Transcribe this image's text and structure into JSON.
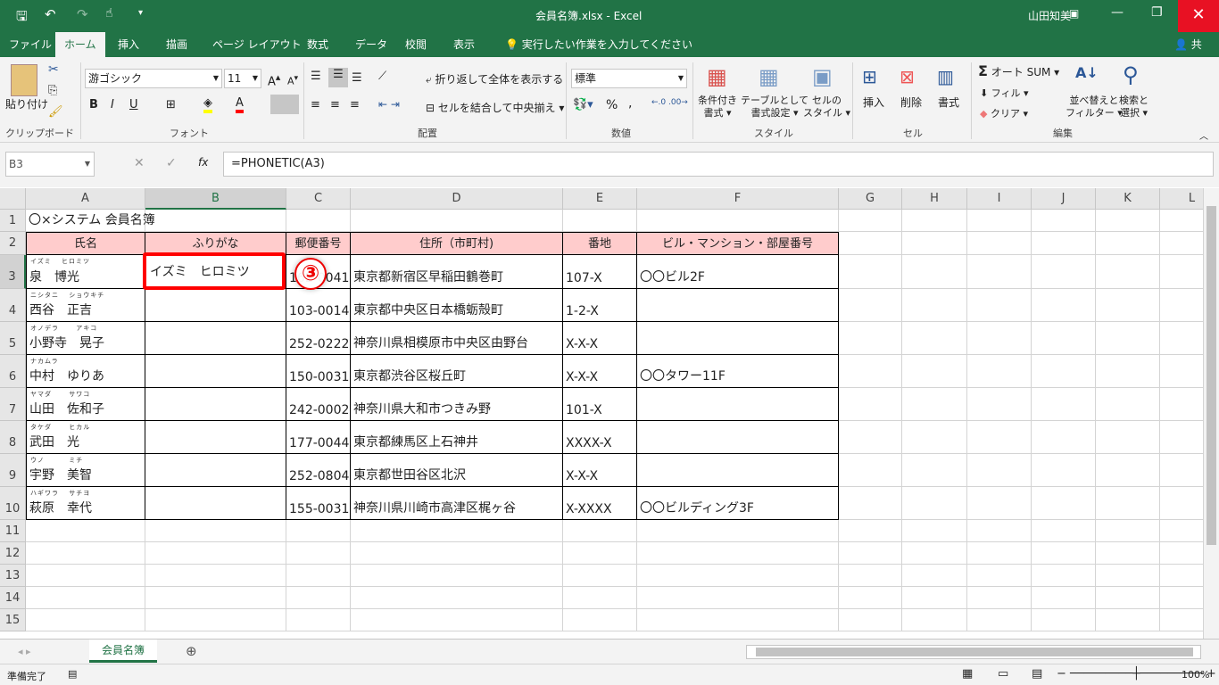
{
  "window": {
    "title": "会員名簿.xlsx  -  Excel",
    "user": "山田知美"
  },
  "tabs": [
    "ファイル",
    "ホーム",
    "挿入",
    "描画",
    "ページ レイアウト",
    "数式",
    "データ",
    "校閲",
    "表示"
  ],
  "tell_me": "実行したい作業を入力してください",
  "share": "共有",
  "ribbon": {
    "clipboard": {
      "paste": "貼り付け",
      "group": "クリップボード"
    },
    "font": {
      "name": "游ゴシック",
      "size": "11",
      "group": "フォント",
      "bold": "B",
      "italic": "I",
      "underline": "U",
      "fill_color": "#ffff00",
      "font_color": "#ff0000"
    },
    "align": {
      "wrap": "折り返して全体を表示する",
      "merge": "セルを結合して中央揃え",
      "group": "配置"
    },
    "number": {
      "format": "標準",
      "group": "数値",
      "percent": "%",
      "comma": ","
    },
    "styles": {
      "cond": [
        "条件付き",
        "書式"
      ],
      "table": [
        "テーブルとして",
        "書式設定"
      ],
      "cell": [
        "セルの",
        "スタイル"
      ],
      "group": "スタイル"
    },
    "cells": {
      "insert": "挿入",
      "delete": "削除",
      "format": "書式",
      "group": "セル"
    },
    "editing": {
      "autosum": "オート SUM",
      "fill": "フィル",
      "clear": "クリア",
      "sort": [
        "並べ替えと",
        "フィルター"
      ],
      "find": [
        "検索と",
        "選択"
      ],
      "group": "編集"
    }
  },
  "formula_bar": {
    "name_box": "B3",
    "fx": "fx",
    "formula": "=PHONETIC(A3)"
  },
  "columns": [
    "A",
    "B",
    "C",
    "D",
    "E",
    "F",
    "G",
    "H",
    "I",
    "J",
    "K",
    "L"
  ],
  "rows": [
    {
      "n": "1",
      "cells": [
        "〇×システム 会員名簿",
        "",
        "",
        "",
        "",
        ""
      ]
    },
    {
      "n": "2",
      "cells": [
        "氏名",
        "ふりがな",
        "郵便番号",
        "住所（市町村)",
        "番地",
        "ビル・マンション・部屋番号"
      ]
    },
    {
      "n": "3",
      "furi": "イズミ　 ヒロミツ",
      "cells": [
        "泉　博光",
        "イズミ　ヒロミツ",
        "162-0041",
        "東京都新宿区早稲田鶴巻町",
        "107-X",
        "〇〇ビル2F"
      ]
    },
    {
      "n": "4",
      "furi": "ニシタニ　 ショウキチ",
      "cells": [
        "西谷　正吉",
        "",
        "103-0014",
        "東京都中央区日本橋蛎殻町",
        "1-2-X",
        ""
      ]
    },
    {
      "n": "5",
      "furi": "オノデラ　　 アキコ",
      "cells": [
        "小野寺　晃子",
        "",
        "252-0222",
        "神奈川県相模原市中央区由野台",
        "X-X-X",
        ""
      ]
    },
    {
      "n": "6",
      "furi": "ナカムラ",
      "cells": [
        "中村　ゆりあ",
        "",
        "150-0031",
        "東京都渋谷区桜丘町",
        "X-X-X",
        "〇〇タワー11F"
      ]
    },
    {
      "n": "7",
      "furi": "ヤマダ　　 サワコ",
      "cells": [
        "山田　佐和子",
        "",
        "242-0002",
        "神奈川県大和市つきみ野",
        "101-X",
        ""
      ]
    },
    {
      "n": "8",
      "furi": "タケダ　　 ヒカル",
      "cells": [
        "武田　光",
        "",
        "177-0044",
        "東京都練馬区上石神井",
        "XXXX-X",
        ""
      ]
    },
    {
      "n": "9",
      "furi": "ウノ　　　 ミチ",
      "cells": [
        "宇野　美智",
        "",
        "252-0804",
        "東京都世田谷区北沢",
        "X-X-X",
        ""
      ]
    },
    {
      "n": "10",
      "furi": "ハギワラ　 サチヨ",
      "cells": [
        "萩原　幸代",
        "",
        "155-0031",
        "神奈川県川崎市高津区梶ヶ谷",
        "X-XXXX",
        "〇〇ビルディング3F"
      ]
    },
    {
      "n": "11",
      "cells": []
    },
    {
      "n": "12",
      "cells": []
    },
    {
      "n": "13",
      "cells": []
    },
    {
      "n": "14",
      "cells": []
    },
    {
      "n": "15",
      "cells": []
    }
  ],
  "annotation": "③",
  "header_fill": "#ffcccc",
  "highlight_color": "#ff0000",
  "sheet_tab": "会員名簿",
  "status": {
    "ready": "準備完了",
    "zoom": "100%"
  }
}
